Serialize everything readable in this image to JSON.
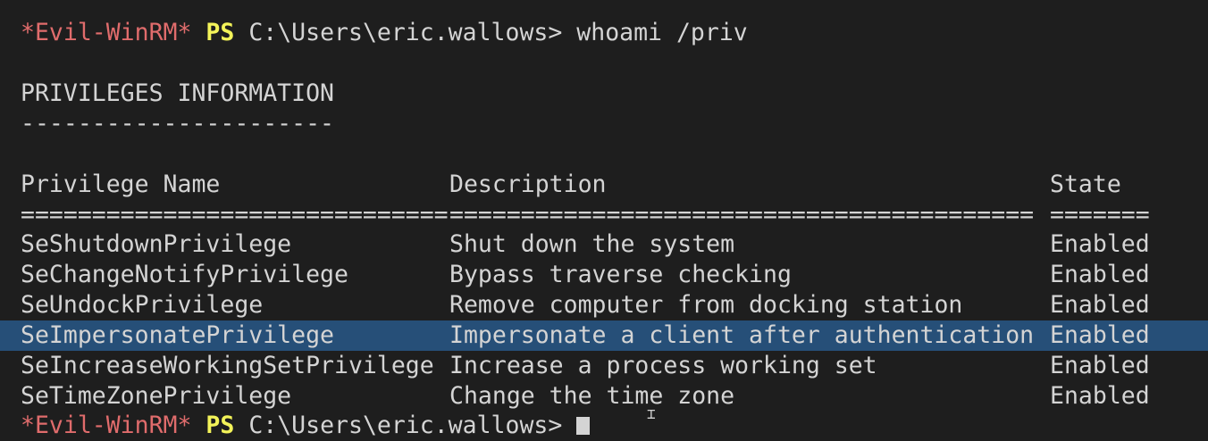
{
  "prompt1": {
    "evil": "*Evil-WinRM*",
    "ps": "PS",
    "path": "C:\\Users\\eric.wallows>",
    "command": "whoami /priv"
  },
  "section": {
    "title": "PRIVILEGES INFORMATION",
    "underline": "----------------------"
  },
  "table": {
    "headers": [
      "Privilege Name",
      "Description",
      "State"
    ],
    "separators": [
      "==============================",
      "=========================================",
      "======="
    ],
    "rows": [
      [
        "SeShutdownPrivilege",
        "Shut down the system",
        "Enabled"
      ],
      [
        "SeChangeNotifyPrivilege",
        "Bypass traverse checking",
        "Enabled"
      ],
      [
        "SeUndockPrivilege",
        "Remove computer from docking station",
        "Enabled"
      ],
      [
        "SeImpersonatePrivilege",
        "Impersonate a client after authentication",
        "Enabled"
      ],
      [
        "SeIncreaseWorkingSetPrivilege",
        "Increase a process working set",
        "Enabled"
      ],
      [
        "SeTimeZonePrivilege",
        "Change the time zone",
        "Enabled"
      ]
    ],
    "selected_row_index": 3
  },
  "prompt2": {
    "evil": "*Evil-WinRM*",
    "ps": "PS",
    "path": "C:\\Users\\eric.wallows>"
  },
  "colors": {
    "background": "#1e1e1e",
    "text": "#d4d4d4",
    "evil": "#e06c6c",
    "ps": "#f3f359",
    "selection": "#264f78"
  }
}
